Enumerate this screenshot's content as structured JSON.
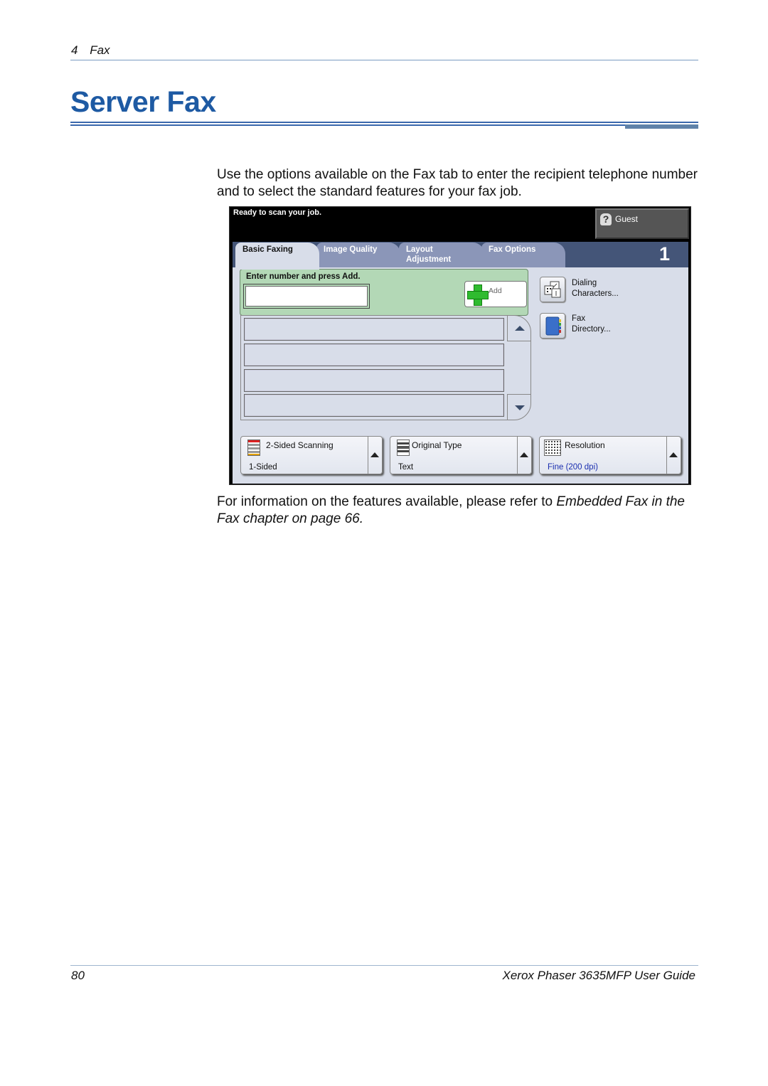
{
  "running_header": {
    "chapter_number": "4",
    "chapter_title": "Fax"
  },
  "page_title": "Server Fax",
  "intro_paragraph": "Use the options available on the Fax tab to enter the recipient telephone number and to select the standard features for your fax job.",
  "closing_paragraph": {
    "prefix": "For information on the features available, please refer to ",
    "reference": "Embedded Fax in the Fax chapter on page 66."
  },
  "screen": {
    "status_message": "Ready to scan your job.",
    "user_button": {
      "label": "Guest",
      "icon": "help-question-icon"
    },
    "tabs": [
      {
        "label": "Basic Faxing",
        "active": true
      },
      {
        "label": "Image Quality",
        "active": false
      },
      {
        "label": "Layout Adjustment",
        "active": false
      },
      {
        "label": "Fax Options",
        "active": false
      }
    ],
    "job_count": "1",
    "entry": {
      "label": "Enter number and press Add.",
      "input_value": "",
      "add_button_label": "Add",
      "add_icon": "green-plus-icon"
    },
    "side_buttons": [
      {
        "label_line1": "Dialing",
        "label_line2": "Characters...",
        "icon": "dialing-characters-icon"
      },
      {
        "label_line1": "Fax",
        "label_line2": "Directory...",
        "icon": "address-book-icon"
      }
    ],
    "recipient_list": {
      "rows": [
        "",
        "",
        "",
        ""
      ]
    },
    "features": [
      {
        "title": "2-Sided Scanning",
        "value": "1-Sided",
        "icon": "two-sided-scanning-icon"
      },
      {
        "title": "Original Type",
        "value": "Text",
        "icon": "original-type-icon"
      },
      {
        "title": "Resolution",
        "value": "Fine (200 dpi)",
        "icon": "resolution-icon"
      }
    ],
    "colors": {
      "tab_bar": "#445578",
      "panel": "#d8dde9",
      "entry_area": "#b3d8b6",
      "resolution_value": "#1b2fb0"
    }
  },
  "footer": {
    "page_number": "80",
    "guide_title": "Xerox Phaser 3635MFP User Guide"
  },
  "colors": {
    "title": "#1e5aa3",
    "rules": "#3a68ad"
  }
}
